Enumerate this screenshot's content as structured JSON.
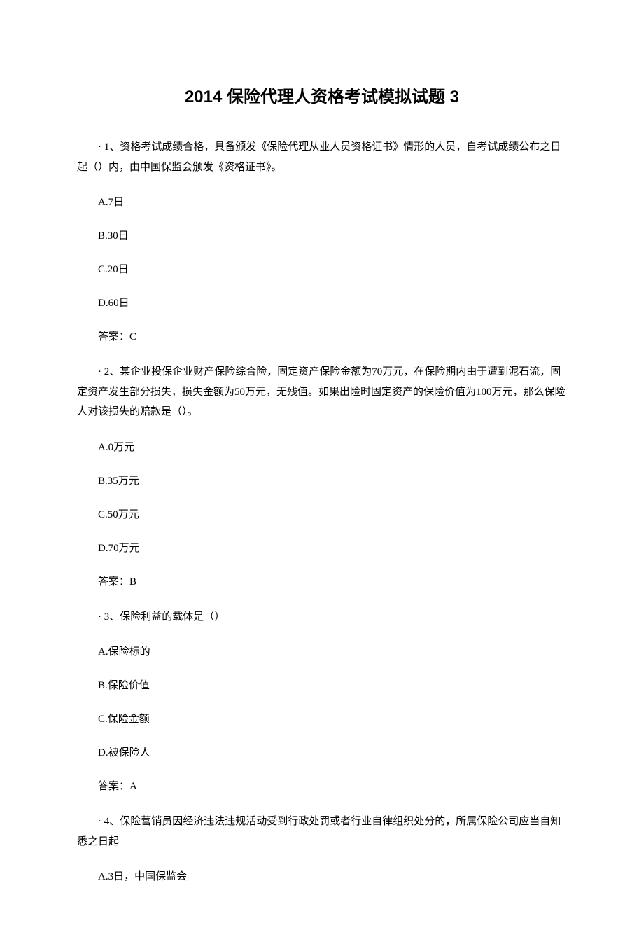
{
  "title": "2014 保险代理人资格考试模拟试题 3",
  "questions": [
    {
      "bullet": "·",
      "stem": "1、资格考试成绩合格，具备颁发《保险代理从业人员资格证书》情形的人员，自考试成绩公布之日起（）内，由中国保监会颁发《资格证书》。",
      "options": {
        "A": "A.7日",
        "B": "B.30日",
        "C": "C.20日",
        "D": "D.60日"
      },
      "answer": "答案：C"
    },
    {
      "bullet": "·",
      "stem": "2、某企业投保企业财产保险综合险，固定资产保险金额为70万元，在保险期内由于遭到泥石流，固定资产发生部分损失，损失金额为50万元，无残值。如果出险时固定资产的保险价值为100万元，那么保险人对该损失的赔款是（）。",
      "options": {
        "A": "A.0万元",
        "B": "B.35万元",
        "C": "C.50万元",
        "D": "D.70万元"
      },
      "answer": "答案：B"
    },
    {
      "bullet": "·",
      "stem": "3、保险利益的载体是（）",
      "options": {
        "A": "A.保险标的",
        "B": "B.保险价值",
        "C": "C.保险金额",
        "D": "D.被保险人"
      },
      "answer": "答案：A"
    },
    {
      "bullet": "·",
      "stem": "4、保险营销员因经济违法违规活动受到行政处罚或者行业自律组织处分的，所属保险公司应当自知悉之日起",
      "options": {
        "A": "A.3日，中国保监会"
      }
    }
  ]
}
